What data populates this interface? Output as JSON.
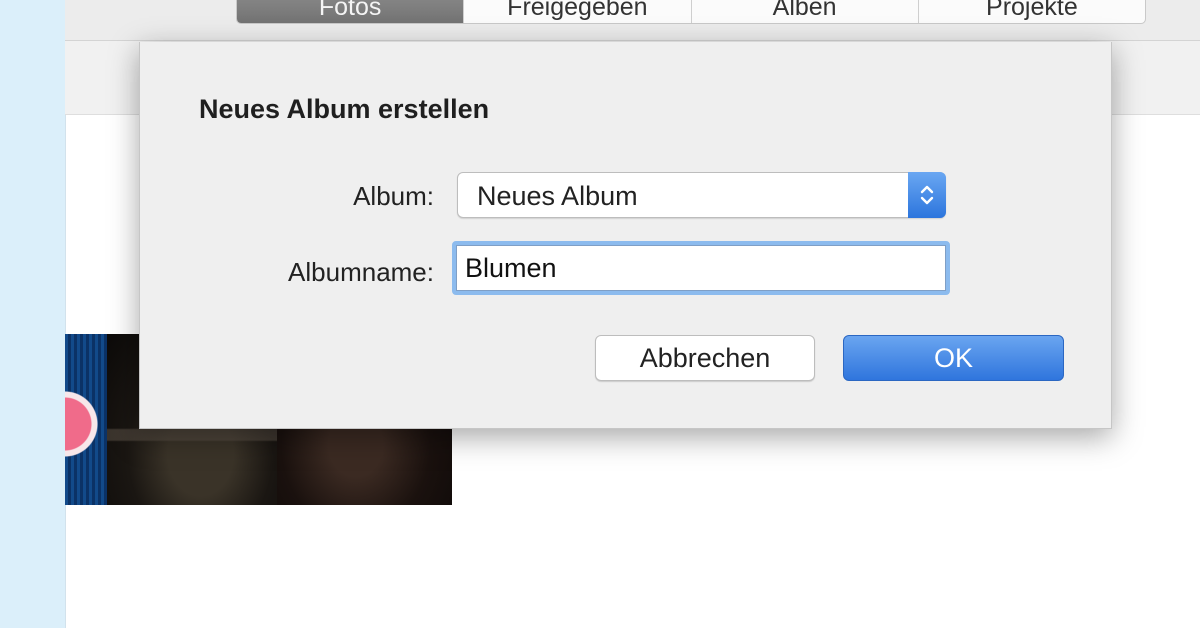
{
  "toolbar": {
    "tabs": [
      {
        "label": "Fotos",
        "selected": true
      },
      {
        "label": "Freigegeben",
        "selected": false
      },
      {
        "label": "Alben",
        "selected": false
      },
      {
        "label": "Projekte",
        "selected": false
      }
    ]
  },
  "dialog": {
    "title": "Neues Album erstellen",
    "album_label": "Album:",
    "album_value": "Neues Album",
    "albumname_label": "Albumname:",
    "albumname_value": "Blumen",
    "cancel_label": "Abbrechen",
    "ok_label": "OK"
  },
  "colors": {
    "sidebar": "#dbeffa",
    "accent": "#2f75dd",
    "focus_ring": "#8cbbee"
  },
  "icons": {
    "album_select_arrows": "updown-chevrons-icon"
  }
}
